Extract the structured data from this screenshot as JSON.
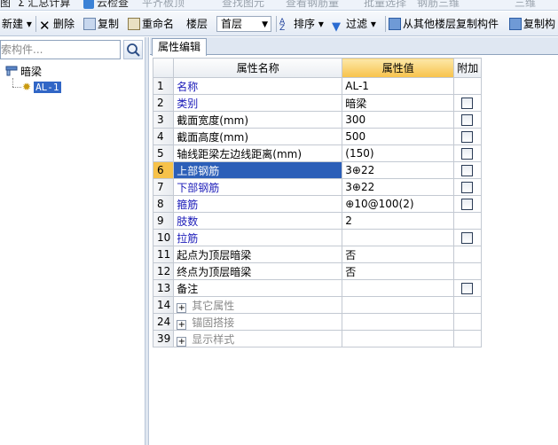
{
  "top_strip": {
    "items": [
      "图",
      "Σ 汇总计算",
      "云检查",
      "平齐板顶",
      "查找图元",
      "查看钢筋量",
      "批量选择",
      "钢筋三维",
      "三维"
    ]
  },
  "toolbar": {
    "new_label": "新建",
    "delete_label": "删除",
    "copy_label": "复制",
    "rename_label": "重命名",
    "floor_label": "楼层",
    "floor_value": "首层",
    "sort_label": "排序",
    "filter_label": "过滤",
    "copy_from_floor_label": "从其他楼层复制构件",
    "copy_component_label": "复制构"
  },
  "left_panel": {
    "search_placeholder": "索构件...",
    "tree_root": "暗梁",
    "tree_child": "AL-1"
  },
  "tab": {
    "label": "属性编辑"
  },
  "grid": {
    "headers": {
      "name": "属性名称",
      "value": "属性值",
      "extra": "附加"
    },
    "rows": [
      {
        "num": "1",
        "name": "名称",
        "value": "AL-1"
      },
      {
        "num": "2",
        "name": "类别",
        "value": "暗梁"
      },
      {
        "num": "3",
        "name": "截面宽度(mm)",
        "value": "300"
      },
      {
        "num": "4",
        "name": "截面高度(mm)",
        "value": "500"
      },
      {
        "num": "5",
        "name": "轴线距梁左边线距离(mm)",
        "value": "(150)"
      },
      {
        "num": "6",
        "name": "上部钢筋",
        "value": "3⊕22"
      },
      {
        "num": "7",
        "name": "下部钢筋",
        "value": "3⊕22"
      },
      {
        "num": "8",
        "name": "箍筋",
        "value": "⊕10@100(2)"
      },
      {
        "num": "9",
        "name": "肢数",
        "value": "2"
      },
      {
        "num": "10",
        "name": "拉筋",
        "value": ""
      },
      {
        "num": "11",
        "name": "起点为顶层暗梁",
        "value": "否"
      },
      {
        "num": "12",
        "name": "终点为顶层暗梁",
        "value": "否"
      },
      {
        "num": "13",
        "name": "备注",
        "value": ""
      },
      {
        "num": "14",
        "name": "其它属性",
        "value": ""
      },
      {
        "num": "24",
        "name": "锚固搭接",
        "value": ""
      },
      {
        "num": "39",
        "name": "显示样式",
        "value": ""
      }
    ]
  }
}
